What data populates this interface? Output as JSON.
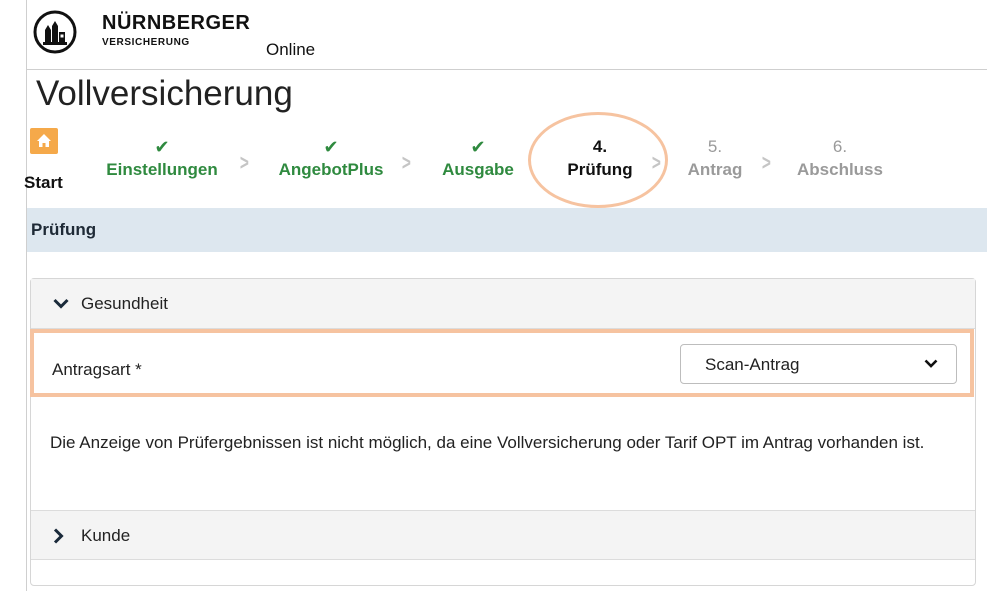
{
  "header": {
    "brand_name": "NÜRNBERGER",
    "brand_sub": "VERSICHERUNG",
    "online_label": "Online"
  },
  "page_title": "Vollversicherung",
  "stepper": {
    "start_label": "Start",
    "steps": [
      {
        "top": "✔",
        "label": "Einstellungen",
        "state": "done"
      },
      {
        "top": "✔",
        "label": "AngebotPlus",
        "state": "done"
      },
      {
        "top": "✔",
        "label": "Ausgabe",
        "state": "done"
      },
      {
        "top": "4.",
        "label": "Prüfung",
        "state": "current"
      },
      {
        "top": "5.",
        "label": "Antrag",
        "state": "future"
      },
      {
        "top": "6.",
        "label": "Abschluss",
        "state": "future"
      }
    ]
  },
  "section": {
    "title": "Prüfung"
  },
  "accordion": {
    "gesundheit_label": "Gesundheit",
    "kunde_label": "Kunde"
  },
  "form": {
    "antragsart_label": "Antragsart *",
    "antragsart_value": "Scan-Antrag"
  },
  "info_text": "Die Anzeige von Prüfergebnissen ist nicht möglich, da eine Vollversicherung oder Tarif OPT im Antrag vorhanden ist.",
  "colors": {
    "accent_done": "#2f8a3f",
    "home_box": "#f5a94a",
    "highlight": "#f6c3a0",
    "section_bar": "#dde7ef"
  }
}
